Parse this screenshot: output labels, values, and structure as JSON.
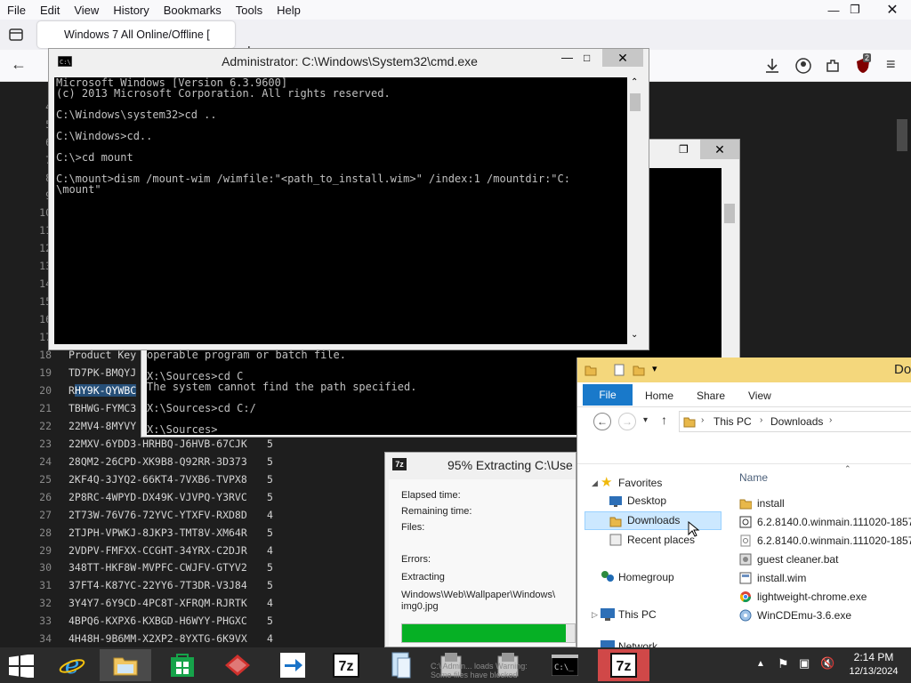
{
  "browser": {
    "menu": [
      "File",
      "Edit",
      "View",
      "History",
      "Bookmarks",
      "Tools",
      "Help"
    ],
    "tab_title": "Windows 7 All Online/Offline [",
    "ublock_badge": "2"
  },
  "page_listing": {
    "visible_numbers_left": [
      "4",
      "5",
      "6",
      "7",
      "8",
      "9",
      "10",
      "11",
      "12",
      "13",
      "14",
      "15",
      "16",
      "17"
    ],
    "header": {
      "line": "18",
      "label": "Product Key"
    },
    "rows": [
      {
        "n": "19",
        "key": "TD7PK-BMQYJ",
        "count": ""
      },
      {
        "n": "20",
        "key_plain": "R",
        "key_hl": "HY9K-QYWBC",
        "count": ""
      },
      {
        "n": "21",
        "key": "TBHWG-FYMC3",
        "count": ""
      },
      {
        "n": "22",
        "key": "22MV4-8MYVY",
        "count": ""
      },
      {
        "n": "23",
        "key": "22MXV-6YDD3-HRHBQ-J6HVB-67CJK",
        "count": "5"
      },
      {
        "n": "24",
        "key": "28QM2-26CPD-XK9B8-Q92RR-3D373",
        "count": "5"
      },
      {
        "n": "25",
        "key": "2KF4Q-3JYQ2-66KT4-7VXB6-TVPX8",
        "count": "5"
      },
      {
        "n": "26",
        "key": "2P8RC-4WPYD-DX49K-VJVPQ-Y3RVC",
        "count": "5"
      },
      {
        "n": "27",
        "key": "2T73W-76V76-72YVC-YTXFV-RXD8D",
        "count": "4"
      },
      {
        "n": "28",
        "key": "2TJPH-VPWKJ-8JKP3-TMT8V-XM64R",
        "count": "5"
      },
      {
        "n": "29",
        "key": "2VDPV-FMFXX-CCGHT-34YRX-C2DJR",
        "count": "4"
      },
      {
        "n": "30",
        "key": "348TT-HKF8W-MVPFC-CWJFV-GTYV2",
        "count": "5"
      },
      {
        "n": "31",
        "key": "37FT4-K87YC-22YY6-7T3DR-V3J84",
        "count": "5"
      },
      {
        "n": "32",
        "key": "3Y4Y7-6Y9CD-4PC8T-XFRQM-RJRTK",
        "count": "4"
      },
      {
        "n": "33",
        "key": "4BPQ6-KXPX6-KXBGD-H6WYY-PHGXC",
        "count": "5"
      },
      {
        "n": "34",
        "key": "4H48H-9B6MM-X2XP2-8YXTG-6K9VX",
        "count": "4"
      }
    ]
  },
  "cmd_main": {
    "title": "Administrator: C:\\Windows\\System32\\cmd.exe",
    "lines": [
      "Microsoft Windows [Version 6.3.9600]",
      "(c) 2013 Microsoft Corporation. All rights reserved.",
      "",
      "C:\\Windows\\system32>cd ..",
      "",
      "C:\\Windows>cd..",
      "",
      "C:\\>cd mount",
      "",
      "C:\\mount>dism /mount-wim /wimfile:\"<path_to_install.wim>\" /index:1 /mountdir:\"C:",
      "\\mount\""
    ]
  },
  "cmd_back": {
    "lines": [
      "operable program or batch file.",
      "",
      "X:\\Sources>cd C",
      "The system cannot find the path specified.",
      "",
      "X:\\Sources>cd C:/",
      "",
      "X:\\Sources>"
    ]
  },
  "extract": {
    "title": "95% Extracting C:\\Use",
    "elapsed_label": "Elapsed time:",
    "remaining_label": "Remaining time:",
    "files_label": "Files:",
    "errors_label": "Errors:",
    "extracting_label": "Extracting",
    "path_line1": "Windows\\Web\\Wallpaper\\Windows\\",
    "path_line2": "img0.jpg",
    "progress_fraction": 0.95
  },
  "explorer": {
    "title": "Do",
    "ribbon_tabs": [
      "File",
      "Home",
      "Share",
      "View"
    ],
    "breadcrumb": [
      "This PC",
      "Downloads"
    ],
    "nav": {
      "favorites": "Favorites",
      "desktop": "Desktop",
      "downloads": "Downloads",
      "recent": "Recent places",
      "homegroup": "Homegroup",
      "thispc": "This PC",
      "network": "Network"
    },
    "column_name": "Name",
    "files": [
      {
        "name": "install",
        "icon": "folder-icon"
      },
      {
        "name": "6.2.8140.0.winmain.111020-1857_",
        "icon": "disc-image-icon"
      },
      {
        "name": "6.2.8140.0.winmain.111020-1857_",
        "icon": "file-icon"
      },
      {
        "name": "guest cleaner.bat",
        "icon": "batch-file-icon"
      },
      {
        "name": "install.wim",
        "icon": "wim-file-icon"
      },
      {
        "name": "lightweight-chrome.exe",
        "icon": "chrome-icon"
      },
      {
        "name": "WinCDEmu-3.6.exe",
        "icon": "wincdemu-icon"
      }
    ]
  },
  "taskbar": {
    "time": "2:14 PM",
    "date": "12/13/2024",
    "preview_text": "C:\\ Admin... loads Warning: Some files have blocked"
  }
}
